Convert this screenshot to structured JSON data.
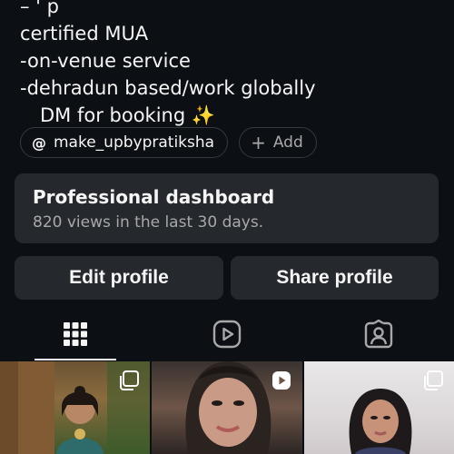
{
  "bio": {
    "partial_top": "– ' p",
    "line1": "certified MUA",
    "line2": "-on-venue service",
    "line3": "-dehradun based/work globally",
    "line4": "DM for booking",
    "line4_emoji": "✨"
  },
  "chips": {
    "threads_icon": "@",
    "threads_handle": "make_upbypratiksha",
    "add_symbol": "+",
    "add_label": "Add"
  },
  "dashboard": {
    "title": "Professional dashboard",
    "subtitle": "820 views in the last 30 days."
  },
  "buttons": {
    "edit": "Edit profile",
    "share": "Share profile"
  },
  "tabs": [
    {
      "name": "posts-grid",
      "icon": "grid-icon",
      "active": true
    },
    {
      "name": "reels",
      "icon": "reels-icon",
      "active": false
    },
    {
      "name": "tagged",
      "icon": "tagged-person-icon",
      "active": false
    }
  ],
  "posts": [
    {
      "type": "carousel",
      "icon": "carousel-icon"
    },
    {
      "type": "reel",
      "icon": "reel-play-icon"
    },
    {
      "type": "carousel",
      "icon": "carousel-icon"
    }
  ],
  "colors": {
    "background": "#0c1014",
    "surface": "#25292e",
    "text": "#f5f5f5",
    "muted": "#a8a8a8"
  }
}
